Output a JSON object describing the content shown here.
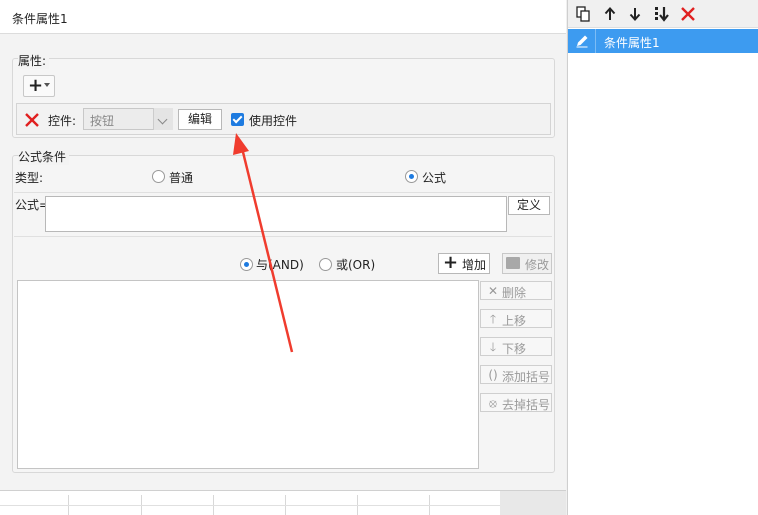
{
  "window": {
    "title": "条件属性1"
  },
  "attributes": {
    "legend": "属性:",
    "control_label": "控件:",
    "control_select_value": "按钮",
    "edit_label": "编辑",
    "use_control_label": "使用控件",
    "use_control_checked": true
  },
  "formula_condition": {
    "legend": "公式条件",
    "type_label": "类型:",
    "type_options": [
      "普通",
      "公式"
    ],
    "type_selected": "公式",
    "formula_label": "公式=",
    "formula_value": "",
    "define_label": "定义",
    "logic_options": [
      "与(AND)",
      "或(OR)"
    ],
    "logic_selected": "与(AND)",
    "add_label": "增加",
    "modify_label": "修改",
    "side_buttons": {
      "delete": "删除",
      "up": "上移",
      "down": "下移",
      "add_paren": "添加括号",
      "remove_paren": "去掉括号"
    }
  },
  "right_panel": {
    "toolbar_icons": [
      "copy-icon",
      "arrow-up-icon",
      "arrow-down-icon",
      "move-bottom-icon",
      "delete-icon"
    ],
    "items": [
      {
        "label": "条件属性1",
        "selected": true
      }
    ]
  },
  "colors": {
    "accent": "#1e7be0",
    "selection": "#3d9bf0",
    "delete_red": "#e02020",
    "annotation_arrow": "#f03c2e"
  }
}
